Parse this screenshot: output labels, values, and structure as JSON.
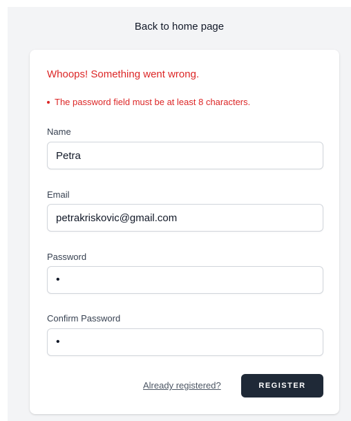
{
  "header": {
    "back_link": "Back to home page"
  },
  "errors": {
    "title": "Whoops! Something went wrong.",
    "items": [
      "The password field must be at least 8 characters."
    ]
  },
  "form": {
    "name": {
      "label": "Name",
      "value": "Petra"
    },
    "email": {
      "label": "Email",
      "value": "petrakriskovic@gmail.com"
    },
    "password": {
      "label": "Password",
      "value": "x"
    },
    "confirm_password": {
      "label": "Confirm Password",
      "value": "x"
    }
  },
  "actions": {
    "already_registered": "Already registered?",
    "register": "REGISTER"
  },
  "colors": {
    "error": "#dc2626",
    "page_background": "#f3f4f6",
    "button_background": "#1f2937"
  }
}
